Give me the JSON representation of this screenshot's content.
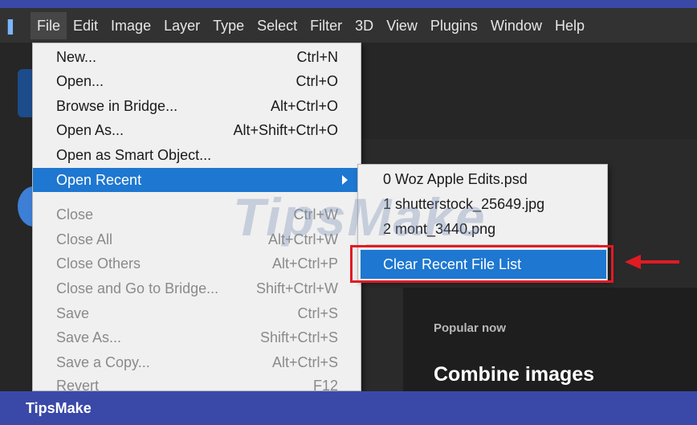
{
  "menubar": {
    "items": [
      "File",
      "Edit",
      "Image",
      "Layer",
      "Type",
      "Select",
      "Filter",
      "3D",
      "View",
      "Plugins",
      "Window",
      "Help"
    ]
  },
  "file_menu": {
    "items": [
      {
        "label": "New...",
        "shortcut": "Ctrl+N",
        "state": "normal"
      },
      {
        "label": "Open...",
        "shortcut": "Ctrl+O",
        "state": "normal"
      },
      {
        "label": "Browse in Bridge...",
        "shortcut": "Alt+Ctrl+O",
        "state": "normal"
      },
      {
        "label": "Open As...",
        "shortcut": "Alt+Shift+Ctrl+O",
        "state": "normal"
      },
      {
        "label": "Open as Smart Object...",
        "shortcut": "",
        "state": "normal"
      },
      {
        "label": "Open Recent",
        "shortcut": "",
        "state": "selected",
        "submenu": true
      },
      {
        "label": "Close",
        "shortcut": "Ctrl+W",
        "state": "disabled"
      },
      {
        "label": "Close All",
        "shortcut": "Alt+Ctrl+W",
        "state": "disabled"
      },
      {
        "label": "Close Others",
        "shortcut": "Alt+Ctrl+P",
        "state": "disabled"
      },
      {
        "label": "Close and Go to Bridge...",
        "shortcut": "Shift+Ctrl+W",
        "state": "disabled"
      },
      {
        "label": "Save",
        "shortcut": "Ctrl+S",
        "state": "disabled"
      },
      {
        "label": "Save As...",
        "shortcut": "Shift+Ctrl+S",
        "state": "disabled"
      },
      {
        "label": "Save a Copy...",
        "shortcut": "Alt+Ctrl+S",
        "state": "disabled"
      },
      {
        "label": "Revert",
        "shortcut": "F12",
        "state": "disabled"
      }
    ]
  },
  "recent_submenu": {
    "files": [
      "0  Woz Apple Edits.psd",
      "1  shutterstock_25649.jpg",
      "2  mont_3440.png"
    ],
    "clear_label": "Clear Recent File List"
  },
  "home_panel": {
    "popular_label": "Popular now",
    "feature_title": "Combine images"
  },
  "watermark": "TipsMake",
  "footer": {
    "brand": "TipsMake"
  },
  "colors": {
    "accent": "#1e77d0",
    "highlight": "#e01b24",
    "brand_bar": "#3a49a8"
  }
}
